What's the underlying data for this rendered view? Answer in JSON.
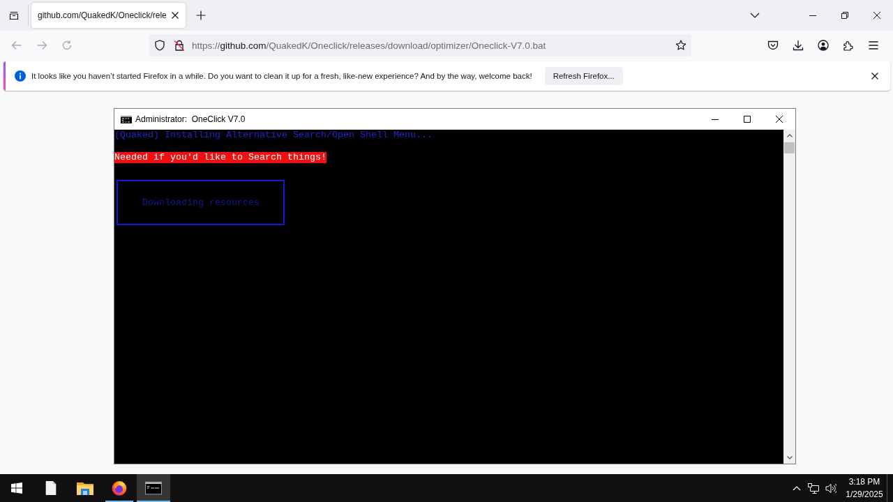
{
  "browser": {
    "tabs": [
      {
        "title": "github.com/QuakedK/Oneclick/rele",
        "selected": true
      }
    ],
    "navigation": [
      {
        "kind": "back",
        "disabled": true
      },
      {
        "kind": "forward",
        "disabled": true
      },
      {
        "kind": "reload",
        "disabled": true
      }
    ],
    "address_bar": {
      "scheme": "https://",
      "host": "github.com",
      "path": "/QuakedK/Oneclick/releases/download/optimizer/Oneclick-V7.0.bat"
    },
    "notification": {
      "message": "It looks like you haven’t started Firefox in a while. Do you want to clean it up for a fresh, like-new experience? And by the way, welcome back!",
      "button": "Refresh Firefox..."
    }
  },
  "console_window": {
    "title": "Administrator:  OneClick V7.0",
    "lines": [
      {
        "kind": "text",
        "text": "(Quaked) Installing Alternative Search/Open Shell Menu..."
      },
      {
        "kind": "highlight",
        "text": "Needed if you'd like to Search things!"
      },
      {
        "kind": "frame",
        "text": "Downloading resources"
      }
    ]
  },
  "taskbar": {
    "apps": [
      {
        "kind": "file",
        "running": false,
        "selected": false
      },
      {
        "kind": "folder",
        "running": false,
        "selected": false
      },
      {
        "kind": "browser",
        "running": true,
        "selected": false
      },
      {
        "kind": "console",
        "running": true,
        "selected": true
      }
    ],
    "clock": {
      "time": "3:18 PM",
      "date": "1/29/2025"
    }
  }
}
